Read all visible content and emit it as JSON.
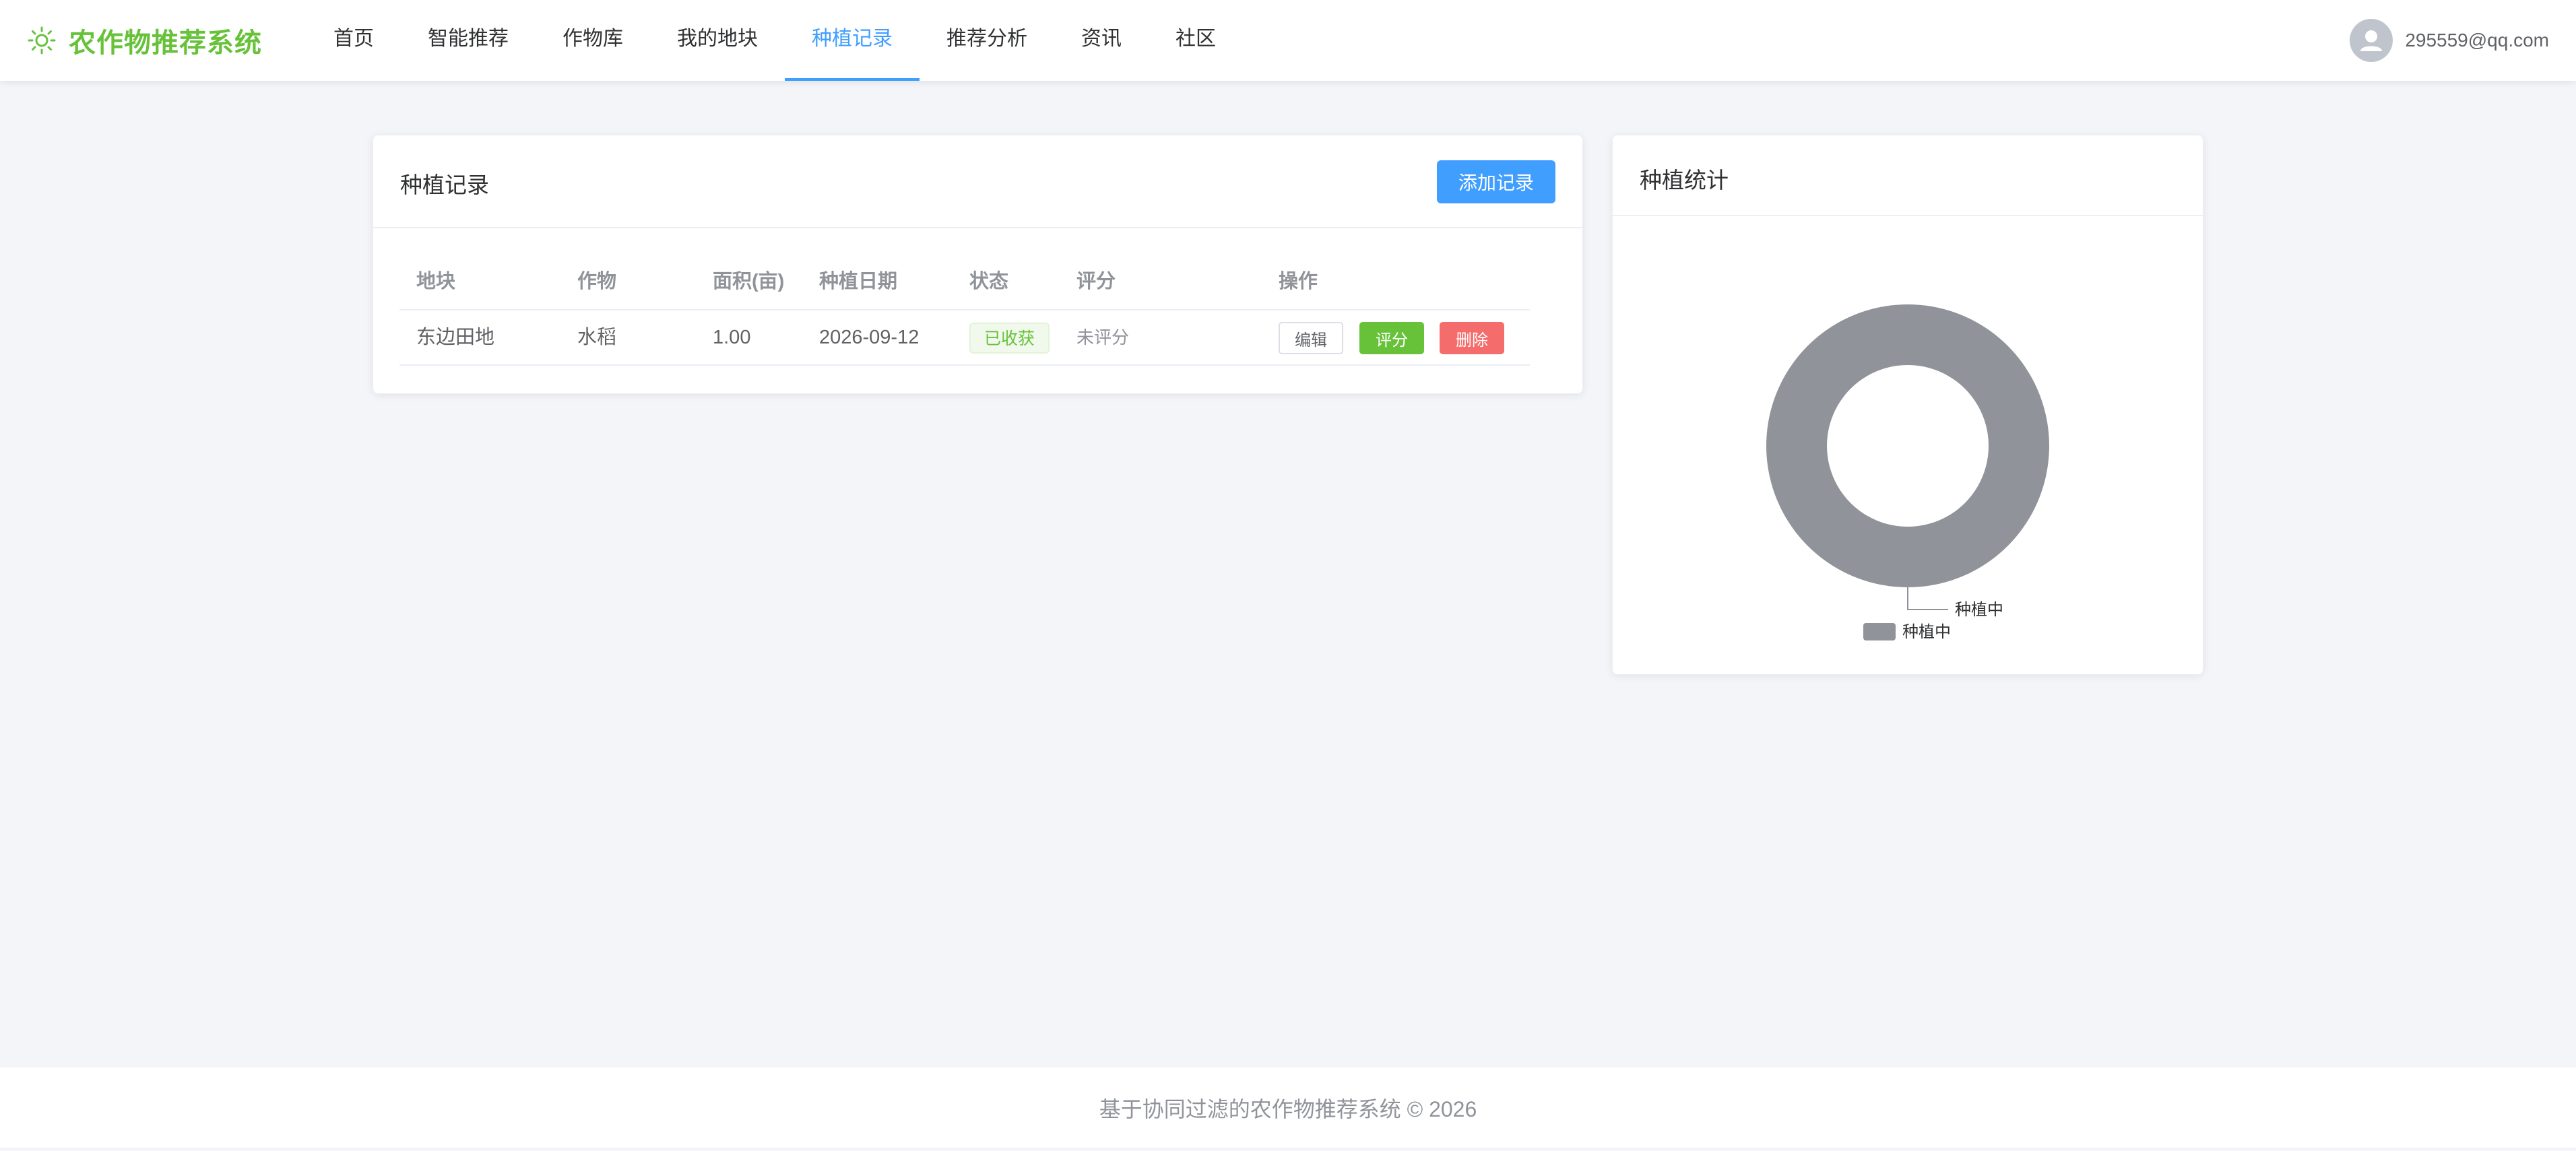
{
  "app": {
    "title": "农作物推荐系统"
  },
  "nav": {
    "items": [
      {
        "label": "首页"
      },
      {
        "label": "智能推荐"
      },
      {
        "label": "作物库"
      },
      {
        "label": "我的地块"
      },
      {
        "label": "种植记录",
        "active": true
      },
      {
        "label": "推荐分析"
      },
      {
        "label": "资讯"
      },
      {
        "label": "社区"
      }
    ]
  },
  "user": {
    "name": "295559@qq.com"
  },
  "records": {
    "title": "种植记录",
    "add_button": "添加记录",
    "columns": [
      "地块",
      "作物",
      "面积(亩)",
      "种植日期",
      "状态",
      "评分",
      "操作"
    ],
    "rows": [
      {
        "plot": "东边田地",
        "crop": "水稻",
        "area": "1.00",
        "date": "2026-09-12",
        "status": "已收获",
        "rating": "未评分",
        "actions": {
          "edit": "编辑",
          "rate": "评分",
          "delete": "删除"
        }
      }
    ]
  },
  "stats": {
    "title": "种植统计"
  },
  "chart_data": {
    "type": "pie",
    "donut": true,
    "title": "",
    "slices": [
      {
        "label": "种植中",
        "value": 1,
        "color": "#909399"
      }
    ],
    "legend": {
      "placement": "bottom",
      "entries": [
        "种植中"
      ]
    }
  },
  "footer": {
    "text": "基于协同过滤的农作物推荐系统 © 2026"
  },
  "colors": {
    "primary": "#409eff",
    "success": "#67c23a",
    "danger": "#f56c6c",
    "brand": "#67c23a",
    "slice": "#909399"
  }
}
